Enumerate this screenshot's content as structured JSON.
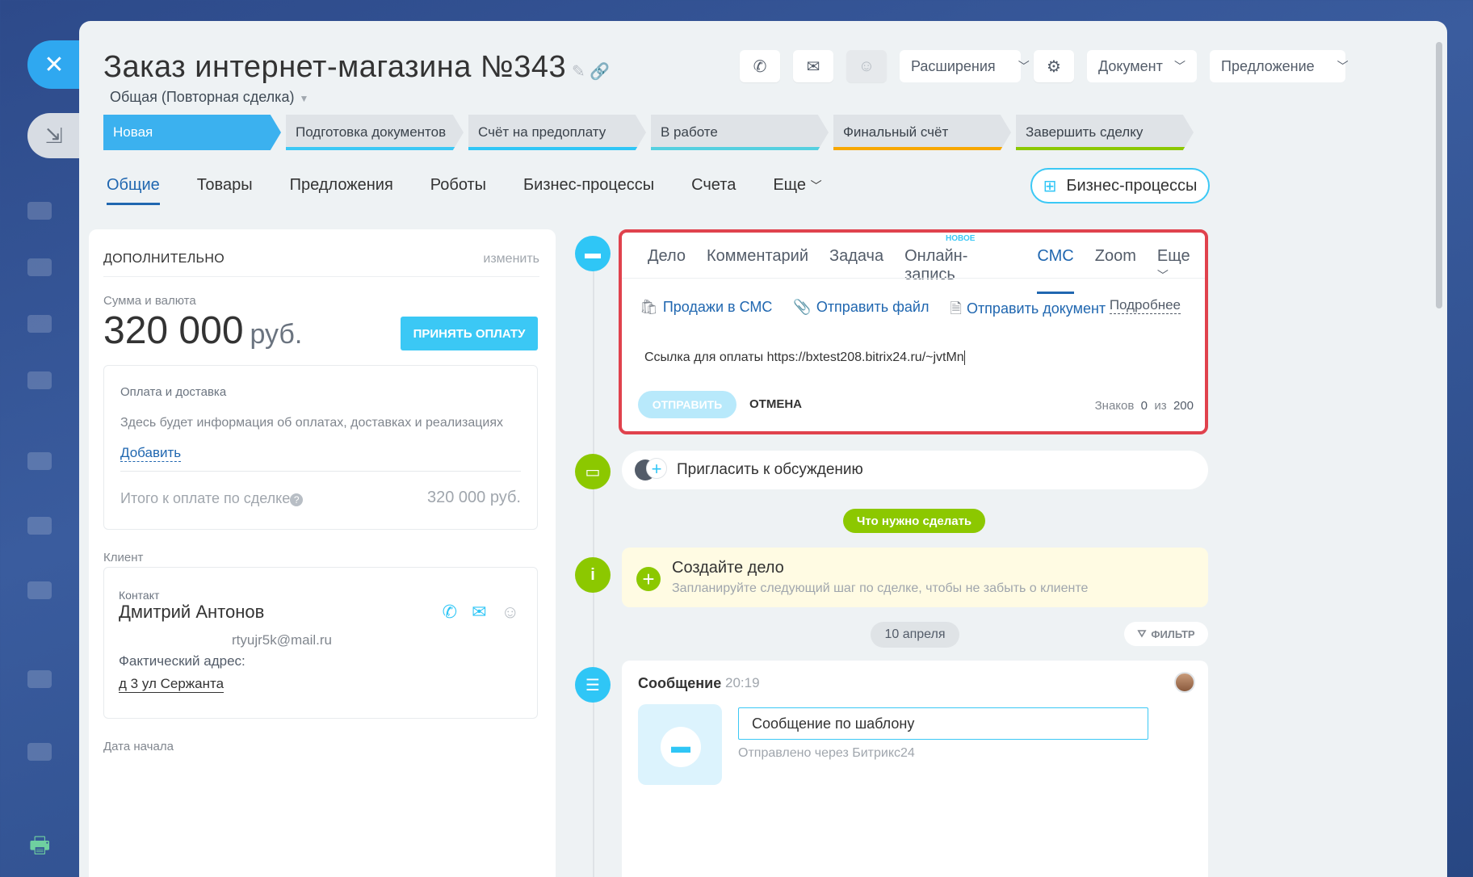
{
  "header": {
    "title": "Заказ интернет-магазина №343",
    "subtitle": "Общая (Повторная сделка)",
    "actions": {
      "extensions": "Расширения",
      "document": "Документ",
      "offer": "Предложение"
    }
  },
  "stages": [
    {
      "label": "Новая",
      "color": "#3bb1ef",
      "active": true
    },
    {
      "label": "Подготовка документов",
      "color": "#3bc8f5"
    },
    {
      "label": "Счёт на предоплату",
      "color": "#2fc6f6"
    },
    {
      "label": "В работе",
      "color": "#55d0e0"
    },
    {
      "label": "Финальный счёт",
      "color": "#f7a700"
    },
    {
      "label": "Завершить сделку",
      "color": "#8cc800"
    }
  ],
  "tabs": [
    "Общие",
    "Товары",
    "Предложения",
    "Роботы",
    "Бизнес-процессы",
    "Счета",
    "Еще"
  ],
  "bp_button": "Бизнес-процессы",
  "left": {
    "section_title": "ДОПОЛНИТЕЛЬНО",
    "edit": "изменить",
    "sum_label": "Сумма и валюта",
    "amount": "320 000",
    "currency": "руб.",
    "pay_button": "ПРИНЯТЬ ОПЛАТУ",
    "payment": {
      "title": "Оплата и доставка",
      "info": "Здесь будет информация об оплатах, доставках и реализациях",
      "add": "Добавить",
      "total_label": "Итого к оплате по сделке",
      "total_value": "320 000 руб."
    },
    "client_label": "Клиент",
    "contact": {
      "type": "Контакт",
      "name": "Дмитрий Антонов",
      "email": "rtyujr5k@mail.ru",
      "address_label": "Фактический адрес:",
      "address": "д 3 ул Сержанта"
    },
    "start_date_label": "Дата начала"
  },
  "editor": {
    "tabs": [
      "Дело",
      "Комментарий",
      "Задача",
      "Онлайн-запись",
      "СМС",
      "Zoom",
      "Еще"
    ],
    "new_badge": "НОВОЕ",
    "actions": [
      "Продажи в СМС",
      "Отправить файл",
      "Отправить документ"
    ],
    "more": "Подробнее",
    "text": "Ссылка для оплаты https://bxtest208.bitrix24.ru/~jvtMn",
    "send": "ОТПРАВИТЬ",
    "cancel": "ОТМЕНА",
    "counter_label": "Знаков",
    "counter_value": "0",
    "counter_of": "из",
    "counter_max": "200"
  },
  "timeline": {
    "invite": "Пригласить к обсуждению",
    "todo_pill": "Что нужно сделать",
    "todo_title": "Создайте дело",
    "todo_sub": "Запланируйте следующий шаг по сделке, чтобы не забыть о клиенте",
    "date": "10 апреля",
    "filter": "ФИЛЬТР",
    "message_title": "Сообщение",
    "message_time": "20:19",
    "message_text": "Сообщение по шаблону",
    "message_sub": "Отправлено через Битрикс24"
  },
  "colors": {
    "accent": "#2fc6f6",
    "highlight_border": "#e0424d",
    "green": "#8cc800"
  }
}
